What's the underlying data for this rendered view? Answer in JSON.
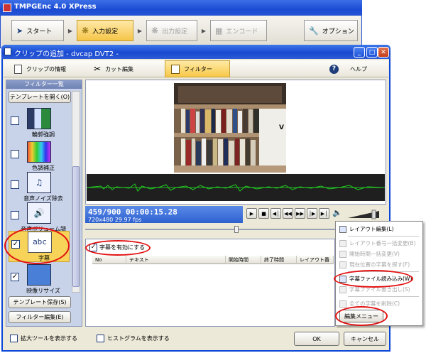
{
  "main_window": {
    "title": "TMPGEnc 4.0 XPress",
    "steps": [
      {
        "label": "スタート",
        "icon": "play-arrow-icon",
        "state": "normal"
      },
      {
        "label": "入力設定",
        "icon": "film-reel-icon",
        "state": "active"
      },
      {
        "label": "出力設定",
        "icon": "film-reel-icon",
        "state": "disabled"
      },
      {
        "label": "エンコード",
        "icon": "film-strip-icon",
        "state": "disabled"
      },
      {
        "label": "オプション",
        "icon": "wrench-icon",
        "state": "normal"
      }
    ]
  },
  "dialog": {
    "title": "クリップの追加 - dvcap DVT2 -",
    "tabs": [
      {
        "label": "クリップの情報",
        "icon": "clip-info-icon"
      },
      {
        "label": "カット編集",
        "icon": "scissors-icon"
      },
      {
        "label": "フィルター",
        "icon": "filter-icon"
      },
      {
        "label": "ヘルプ",
        "icon": "help-icon"
      }
    ],
    "active_tab": "フィルター"
  },
  "filter_panel": {
    "header": "フィルター一覧",
    "open_template": "テンプレートを開く(O)",
    "filters": [
      {
        "label": "輪郭強調",
        "checked": false,
        "selected": false,
        "icon": "edge-enhance-icon"
      },
      {
        "label": "色調補正",
        "checked": false,
        "selected": false,
        "icon": "color-correction-icon"
      },
      {
        "label": "音声ノイズ除去",
        "checked": false,
        "selected": false,
        "icon": "audio-noise-icon"
      },
      {
        "label": "音声ボリューム調整",
        "checked": false,
        "selected": false,
        "icon": "volume-icon"
      },
      {
        "label": "字幕",
        "checked": true,
        "selected": true,
        "icon": "subtitle-abc-icon",
        "icon_text": "abc"
      },
      {
        "label": "映像リサイズ",
        "checked": true,
        "selected": false,
        "icon": "resize-icon"
      }
    ],
    "save_template": "テンプレート保存(S)",
    "filter_edit": "フィルター編集(E)"
  },
  "preview": {
    "timecode": "459/900  00:00:15.28",
    "info": "720x480 29.97 fps",
    "video_overlay": "V"
  },
  "subtitles": {
    "enable_label": "字幕を有効にする",
    "enable_checked": true,
    "columns": [
      "No",
      "テキスト",
      "開始時間",
      "終了時間",
      "レイアウト番号"
    ]
  },
  "context_menu": {
    "items": [
      {
        "label": "レイアウト編集(L)",
        "enabled": true
      },
      {
        "label": "レイアウト番号一括変更(B)",
        "enabled": false
      },
      {
        "label": "開始時間一括変更(V)",
        "enabled": false
      },
      {
        "label": "現在位置の字幕を探す(F)",
        "enabled": false
      },
      {
        "label": "字幕ファイル読み込み(W)",
        "enabled": true,
        "highlighted": true
      },
      {
        "label": "字幕ファイル書き出し(S)",
        "enabled": false
      },
      {
        "label": "全ての字幕を削除(C)",
        "enabled": false
      }
    ],
    "edit_menu_button": "編集メニュー"
  },
  "footer": {
    "show_extended_tools": "拡大ツールを表示する",
    "show_histogram": "ヒストグラムを表示する",
    "ok": "OK",
    "cancel": "キャンセル"
  },
  "colors": {
    "title_blue": "#1c4bd3",
    "highlight_red": "#e31010",
    "selected_yellow": "#f7d35a"
  }
}
